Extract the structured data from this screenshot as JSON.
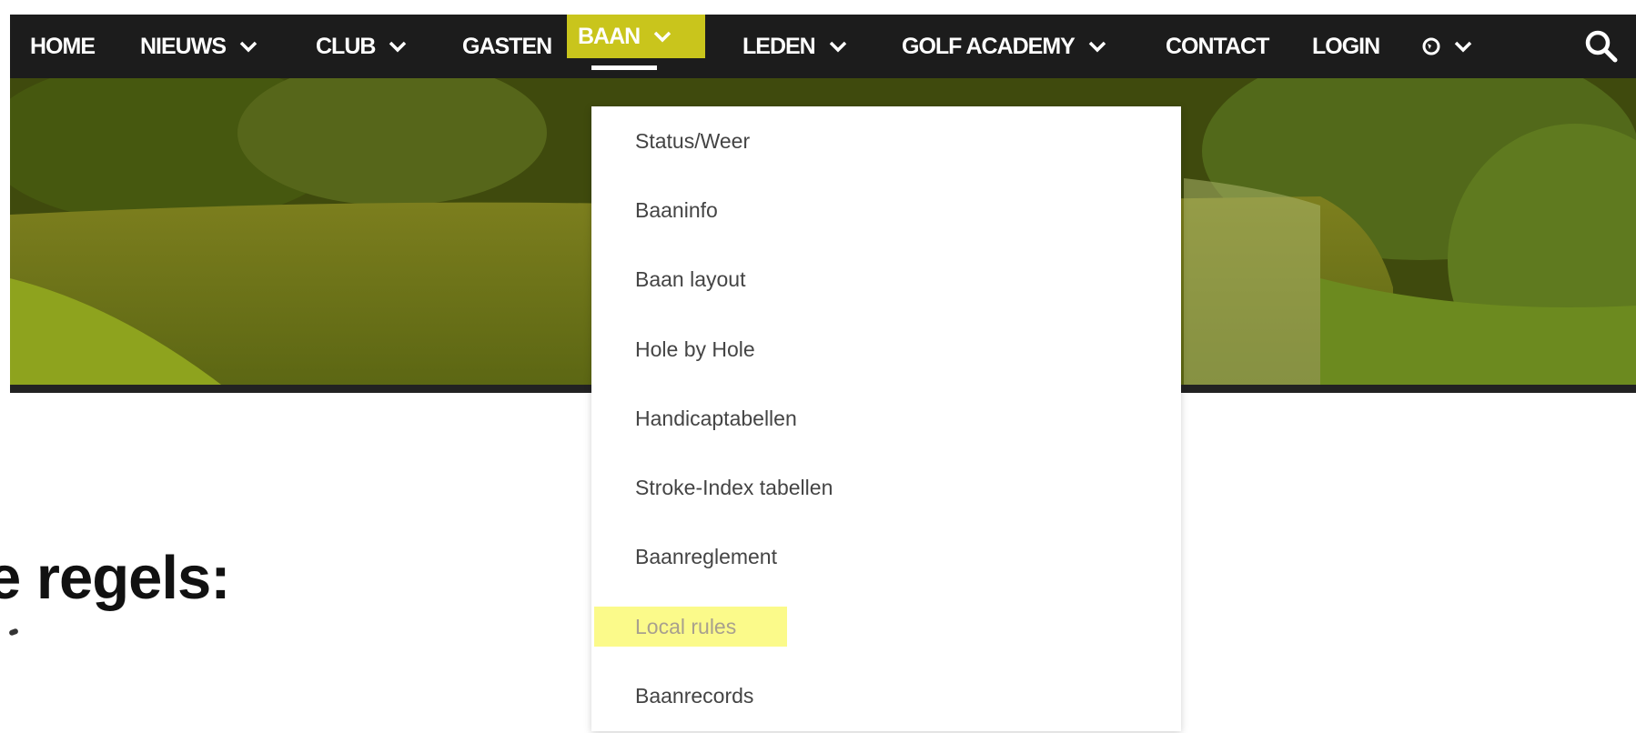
{
  "nav": {
    "items": [
      {
        "label": "HOME",
        "dropdown": false
      },
      {
        "label": "NIEUWS",
        "dropdown": true
      },
      {
        "label": "CLUB",
        "dropdown": true
      },
      {
        "label": "GASTEN",
        "dropdown": false
      },
      {
        "label": "BAAN",
        "dropdown": true,
        "active": true
      },
      {
        "label": "LEDEN",
        "dropdown": true
      },
      {
        "label": "GOLF ACADEMY",
        "dropdown": true
      },
      {
        "label": "CONTACT",
        "dropdown": false
      },
      {
        "label": "LOGIN",
        "dropdown": false
      }
    ],
    "language_icon": "globe-icon",
    "search_icon": "search-icon",
    "highlight_color": "#c9c51c",
    "bar_color": "#1c1c1c"
  },
  "heading": {
    "text": "e regels:"
  },
  "dropdown": {
    "items": [
      {
        "label": "Status/Weer"
      },
      {
        "label": "Baaninfo"
      },
      {
        "label": "Baan layout"
      },
      {
        "label": "Hole by Hole"
      },
      {
        "label": "Handicaptabellen"
      },
      {
        "label": "Stroke-Index tabellen"
      },
      {
        "label": "Baanreglement"
      },
      {
        "label": "Local rules",
        "highlighted": true
      },
      {
        "label": "Baanrecords"
      }
    ],
    "highlight_color": "#fbfa8a"
  }
}
